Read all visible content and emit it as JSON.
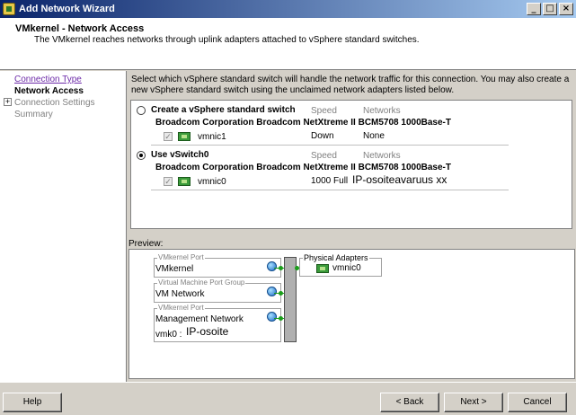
{
  "window": {
    "title": "Add Network Wizard",
    "controls": [
      "_",
      "□",
      "×"
    ]
  },
  "header": {
    "title": "VMkernel - Network Access",
    "subtitle": "The VMkernel reaches networks through uplink adapters attached to vSphere standard switches."
  },
  "nav": {
    "items": [
      {
        "label": "Connection Type",
        "state": "link"
      },
      {
        "label": "Network Access",
        "state": "current"
      },
      {
        "label": "Connection Settings",
        "state": "disabled"
      },
      {
        "label": "Summary",
        "state": "disabled"
      }
    ],
    "expander": "+"
  },
  "main": {
    "instructions": "Select which vSphere standard switch will handle the network traffic for this connection. You may also create a new vSphere standard switch using the unclaimed network adapters listed below.",
    "columns": {
      "speed": "Speed",
      "networks": "Networks"
    },
    "options": [
      {
        "label": "Create a vSphere standard switch",
        "selected": false,
        "adapter": "Broadcom Corporation Broadcom NetXtreme II BCM5708 1000Base-T",
        "nic": {
          "name": "vmnic1",
          "speed": "Down",
          "networks": "None"
        }
      },
      {
        "label": "Use vSwitch0",
        "selected": true,
        "adapter": "Broadcom Corporation Broadcom NetXtreme II BCM5708 1000Base-T",
        "nic": {
          "name": "vmnic0",
          "speed": "1000 Full",
          "networks": "IP-osoiteavaruus xx"
        }
      }
    ]
  },
  "preview": {
    "label": "Preview:",
    "port_groups": [
      {
        "legend": "VMkernel Port",
        "name": "VMkernel",
        "detail": ""
      },
      {
        "legend": "Virtual Machine Port Group",
        "name": "VM Network",
        "detail": ""
      },
      {
        "legend": "VMkernel Port",
        "name": "Management Network",
        "detail": "vmk0 :",
        "annotation": "IP-osoite"
      }
    ],
    "physical_adapters": {
      "legend": "Physical Adapters",
      "nic": "vmnic0"
    }
  },
  "buttons": {
    "help": "Help",
    "back": "< Back",
    "next": "Next >",
    "cancel": "Cancel"
  }
}
